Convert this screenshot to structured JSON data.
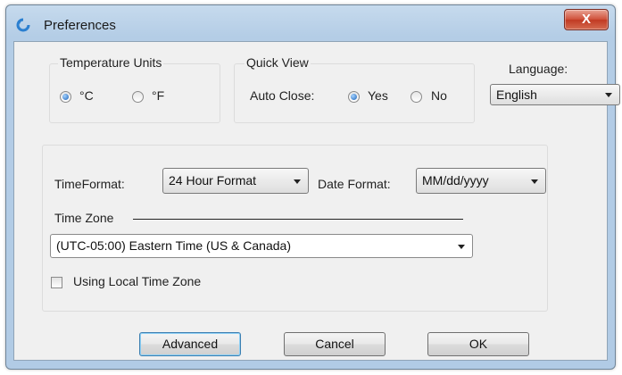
{
  "window": {
    "title": "Preferences",
    "close_glyph": "X"
  },
  "temperature": {
    "legend": "Temperature Units",
    "options": [
      {
        "label": "°C",
        "selected": true
      },
      {
        "label": "°F",
        "selected": false
      }
    ]
  },
  "quick_view": {
    "legend": "Quick View",
    "auto_close_label": "Auto Close:",
    "options": [
      {
        "label": "Yes",
        "selected": true
      },
      {
        "label": "No",
        "selected": false
      }
    ]
  },
  "language": {
    "label": "Language:",
    "value": "English"
  },
  "datetime": {
    "time_format_label": "TimeFormat:",
    "time_format_value": "24 Hour Format",
    "date_format_label": "Date Format:",
    "date_format_value": "MM/dd/yyyy",
    "time_zone_label": "Time Zone",
    "time_zone_value": "(UTC-05:00) Eastern Time (US & Canada)",
    "local_tz_label": "Using Local Time Zone",
    "local_tz_checked": false
  },
  "buttons": {
    "advanced": "Advanced",
    "cancel": "Cancel",
    "ok": "OK"
  },
  "icons": {
    "app": "weather-app-icon",
    "close": "close-icon",
    "dropdown": "chevron-down-icon"
  }
}
